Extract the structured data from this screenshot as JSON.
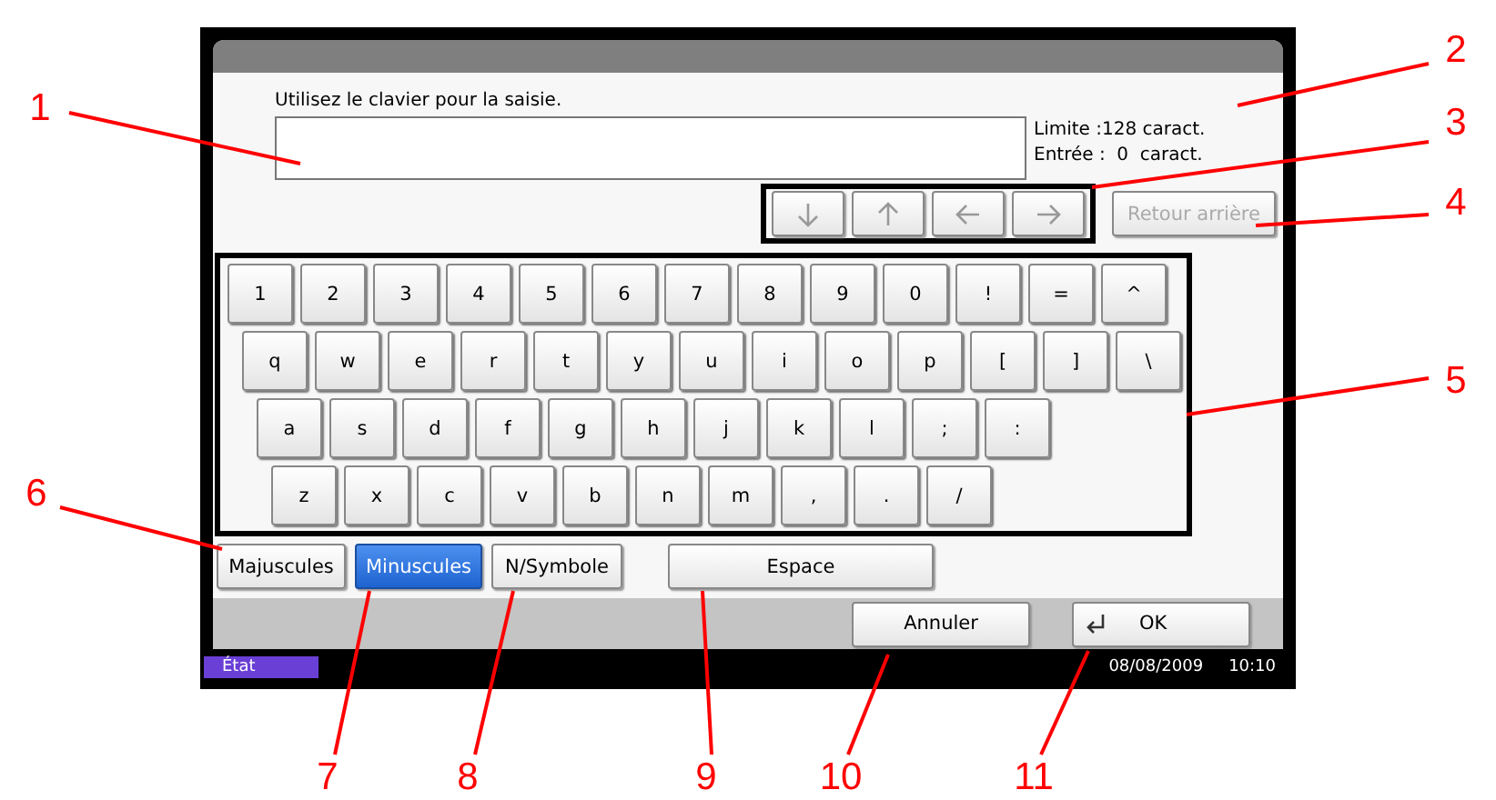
{
  "screen": {
    "prompt": "Utilisez le clavier pour la saisie.",
    "limit": "Limite :128 caract.",
    "entry": "Entrée :  0  caract.",
    "cursor_keys": [
      {
        "kind": "down",
        "disabled": true
      },
      {
        "kind": "up",
        "disabled": true
      },
      {
        "kind": "left",
        "disabled": true
      },
      {
        "kind": "right",
        "disabled": true
      }
    ],
    "backspace": {
      "label": "Retour arrière",
      "disabled": true
    },
    "keyboard": [
      [
        "1",
        "2",
        "3",
        "4",
        "5",
        "6",
        "7",
        "8",
        "9",
        "0",
        "!",
        "=",
        "^"
      ],
      [
        "q",
        "w",
        "e",
        "r",
        "t",
        "y",
        "u",
        "i",
        "o",
        "p",
        "[",
        "]",
        "\\"
      ],
      [
        "a",
        "s",
        "d",
        "f",
        "g",
        "h",
        "j",
        "k",
        "l",
        ";",
        ":"
      ],
      [
        "z",
        "x",
        "c",
        "v",
        "b",
        "n",
        "m",
        ",",
        ".",
        "/"
      ]
    ],
    "modes": [
      {
        "label": "Majuscules",
        "selected": false
      },
      {
        "label": "Minuscules",
        "selected": true
      },
      {
        "label": "N/Symbole",
        "selected": false
      }
    ],
    "space": "Espace",
    "cancel": "Annuler",
    "ok": "OK",
    "status": {
      "label": "État",
      "date": "08/08/2009",
      "time": "10:10"
    }
  },
  "callouts": [
    {
      "label": "1"
    },
    {
      "label": "2"
    },
    {
      "label": "3"
    },
    {
      "label": "4"
    },
    {
      "label": "5"
    },
    {
      "label": "6"
    },
    {
      "label": "7"
    },
    {
      "label": "8"
    },
    {
      "label": "9"
    },
    {
      "label": "10"
    },
    {
      "label": "11"
    }
  ]
}
